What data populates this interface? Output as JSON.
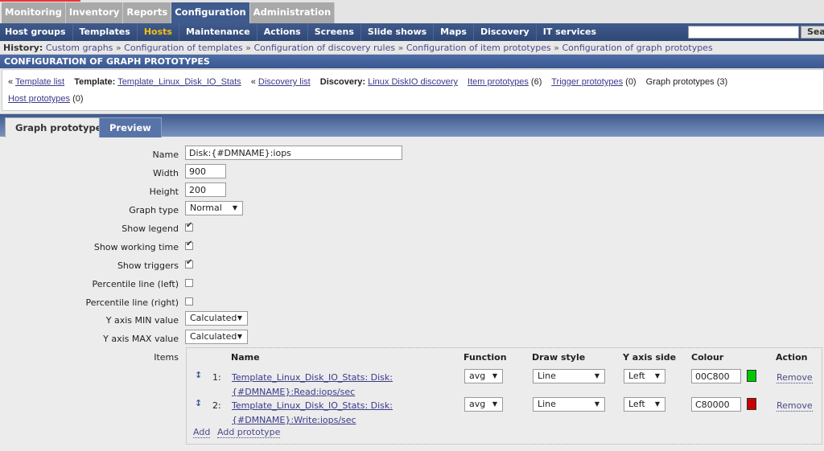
{
  "main_menu": [
    "Monitoring",
    "Inventory",
    "Reports",
    "Configuration",
    "Administration"
  ],
  "main_menu_active": "Configuration",
  "sub_menu": [
    "Host groups",
    "Templates",
    "Hosts",
    "Maintenance",
    "Actions",
    "Screens",
    "Slide shows",
    "Maps",
    "Discovery",
    "IT services"
  ],
  "sub_menu_active": "Hosts",
  "search": {
    "value": "",
    "button": "Search"
  },
  "history": {
    "label": "History:",
    "items": [
      "Custom graphs",
      "Configuration of templates",
      "Configuration of discovery rules",
      "Configuration of item prototypes",
      "Configuration of graph prototypes"
    ]
  },
  "page_title": "CONFIGURATION OF GRAPH PROTOTYPES",
  "links": {
    "template_list": "Template list",
    "template_label": "Template:",
    "template": "Template_Linux_Disk_IO_Stats",
    "discovery_list": "Discovery list",
    "discovery_label": "Discovery:",
    "discovery": "Linux DiskIO discovery",
    "item_prototypes": "Item prototypes",
    "item_count": "(6)",
    "trigger_prototypes": "Trigger prototypes",
    "trigger_count": "(0)",
    "graph_prototypes": "Graph prototypes (3)",
    "host_prototypes": "Host prototypes",
    "host_count": "(0)"
  },
  "tabs": [
    "Graph prototype",
    "Preview"
  ],
  "form": {
    "name_label": "Name",
    "name": "Disk:{#DMNAME}:iops",
    "width_label": "Width",
    "width": "900",
    "height_label": "Height",
    "height": "200",
    "graph_type_label": "Graph type",
    "graph_type": "Normal",
    "show_legend_label": "Show legend",
    "show_legend": true,
    "show_working_time_label": "Show working time",
    "show_working_time": true,
    "show_triggers_label": "Show triggers",
    "show_triggers": true,
    "percentile_left_label": "Percentile line (left)",
    "percentile_left": false,
    "percentile_right_label": "Percentile line (right)",
    "percentile_right": false,
    "ymin_label": "Y axis MIN value",
    "ymin": "Calculated",
    "ymax_label": "Y axis MAX value",
    "ymax": "Calculated",
    "items_label": "Items"
  },
  "items": {
    "headers": [
      "Name",
      "Function",
      "Draw style",
      "Y axis side",
      "Colour",
      "Action"
    ],
    "rows": [
      {
        "num": "1:",
        "name1": "Template_Linux_Disk_IO_Stats: Disk:",
        "name2": "{#DMNAME}:Read:iops/sec",
        "function": "avg",
        "draw_style": "Line",
        "y_axis": "Left",
        "colour": "00C800",
        "colour_hex": "#00C800",
        "action": "Remove"
      },
      {
        "num": "2:",
        "name1": "Template_Linux_Disk_IO_Stats: Disk:",
        "name2": "{#DMNAME}:Write:iops/sec",
        "function": "avg",
        "draw_style": "Line",
        "y_axis": "Left",
        "colour": "C80000",
        "colour_hex": "#C80000",
        "action": "Remove"
      }
    ],
    "add": "Add",
    "add_prototype": "Add prototype"
  }
}
